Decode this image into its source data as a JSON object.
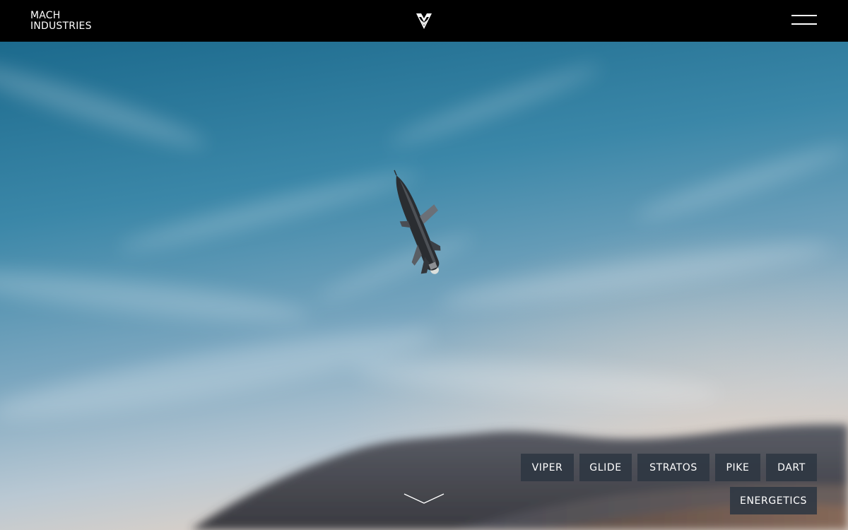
{
  "header": {
    "brand_line1": "MACH",
    "brand_line2": "INDUSTRIES",
    "logo_icon": "mach-chevron-logo-icon",
    "menu_icon": "hamburger-menu-icon"
  },
  "hero": {
    "image": "rocket-in-flight-over-mountains",
    "scroll_icon": "chevron-down-icon"
  },
  "products": [
    {
      "label": "VIPER"
    },
    {
      "label": "GLIDE"
    },
    {
      "label": "STRATOS"
    },
    {
      "label": "PIKE"
    },
    {
      "label": "DART"
    },
    {
      "label": "ENERGETICS"
    }
  ],
  "colors": {
    "topbar": "#000000",
    "sky_top": "#1f6f93",
    "sky_bottom": "#b7c9d6",
    "button_bg": "#2d3742",
    "text": "#ffffff"
  }
}
